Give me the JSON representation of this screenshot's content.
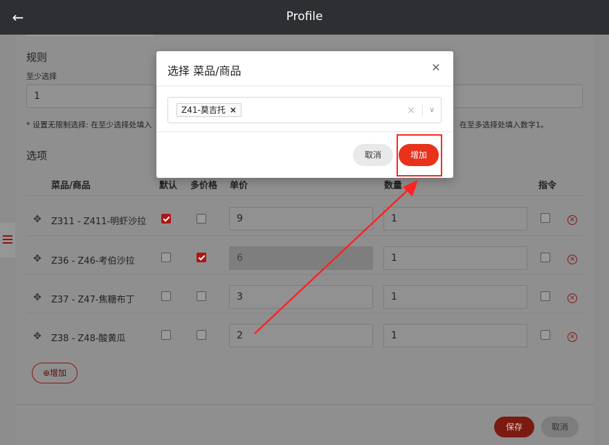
{
  "header": {
    "title": "Profile",
    "back_icon": "arrow-left-icon"
  },
  "rules": {
    "title": "规则",
    "min_label": "至少选择",
    "min_value": "1",
    "hint_left": "* 设置无限制选择: 在至少选择处填入",
    "hint_right": "在至多选择处填入数字1。"
  },
  "options": {
    "title": "选项",
    "columns": {
      "item": "菜品/商品",
      "default": "默认",
      "multi_price": "多价格",
      "price": "单价",
      "qty": "数量",
      "instruction": "指令"
    },
    "rows": [
      {
        "name": "Z311 - Z411-明虾沙拉",
        "default": true,
        "multi": false,
        "price": "9",
        "qty": "1",
        "price_disabled": false
      },
      {
        "name": "Z36 - Z46-考伯沙拉",
        "default": false,
        "multi": true,
        "price": "6",
        "qty": "1",
        "price_disabled": true
      },
      {
        "name": "Z37 - Z47-焦糖布丁",
        "default": false,
        "multi": false,
        "price": "3",
        "qty": "1",
        "price_disabled": false
      },
      {
        "name": "Z38 - Z48-酸黄瓜",
        "default": false,
        "multi": false,
        "price": "2",
        "qty": "1",
        "price_disabled": false
      }
    ],
    "add_label": "增加"
  },
  "footer": {
    "save_label": "保存",
    "cancel_label": "取消"
  },
  "modal": {
    "title": "选择 菜品/商品",
    "selected_tag": "Z41-莫吉托",
    "cancel_label": "取消",
    "add_label": "增加"
  },
  "colors": {
    "accent": "#e8321b",
    "annotation": "#ff2222"
  }
}
